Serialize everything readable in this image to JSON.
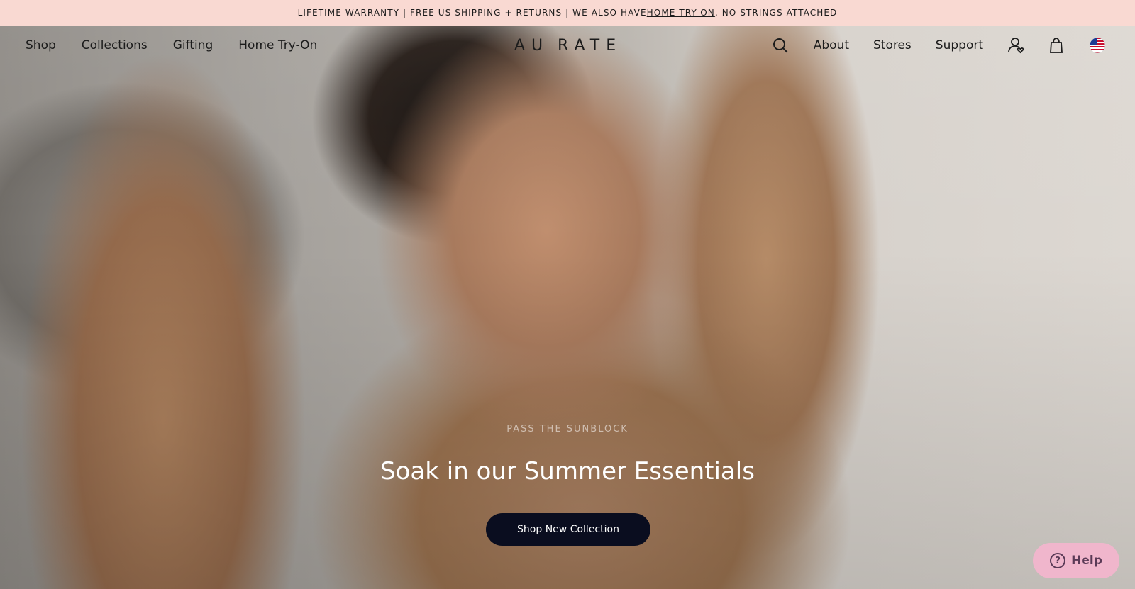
{
  "announcement": {
    "before_link": "LIFETIME WARRANTY | FREE US SHIPPING + RETURNS | WE ALSO HAVE ",
    "link": "HOME TRY-ON",
    "after_link": ", NO STRINGS ATTACHED"
  },
  "nav": {
    "left": [
      "Shop",
      "Collections",
      "Gifting",
      "Home Try-On"
    ],
    "logo_left": "AU",
    "logo_right": "RATE",
    "right": [
      "About",
      "Stores",
      "Support"
    ],
    "icons": {
      "search": "search-icon",
      "account": "account-heart-icon",
      "cart": "shopping-bag-icon",
      "region": "us-flag-icon"
    }
  },
  "hero": {
    "eyebrow": "PASS THE SUNBLOCK",
    "headline": "Soak in our Summer Essentials",
    "cta": "Shop New Collection"
  },
  "help": {
    "label": "Help"
  },
  "colors": {
    "announcement_bg": "#f9d9d2",
    "cta_bg": "#0a0d1f",
    "help_bg": "#f0b6cc"
  }
}
